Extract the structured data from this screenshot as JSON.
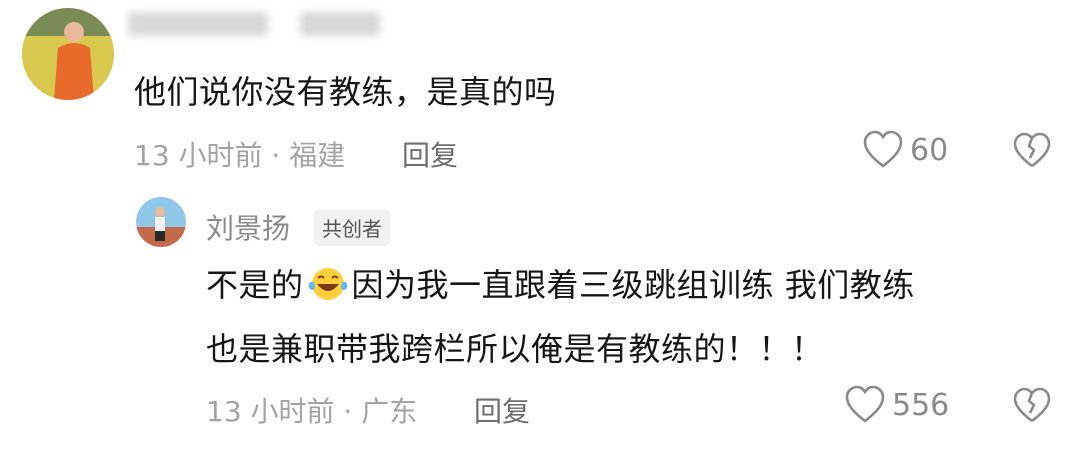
{
  "comment": {
    "text": "他们说你没有教练，是真的吗",
    "meta": "13 小时前 · 福建",
    "reply_label": "回复",
    "like_count": "60"
  },
  "reply": {
    "author": "刘景扬",
    "badge": "共创者",
    "text_line1_part1": "不是的",
    "emoji": "laughing-tears-emoji",
    "text_line1_part2": "因为我一直跟着三级跳组训练 我们教练",
    "text_line2": "也是兼职带我跨栏所以俺是有教练的！！！",
    "meta": "13 小时前 · 广东",
    "reply_label": "回复",
    "like_count": "556"
  },
  "colors": {
    "text": "#161616",
    "meta": "#a3a3a3",
    "icon": "#8a8a8a"
  }
}
